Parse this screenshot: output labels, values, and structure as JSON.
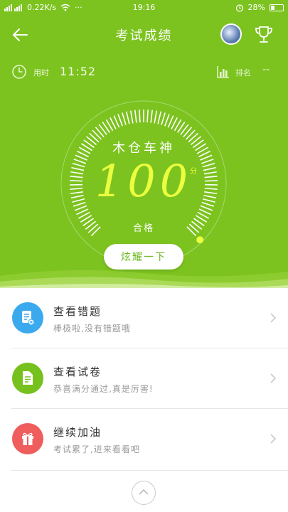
{
  "status_bar": {
    "network": "0.22K/s",
    "time": "19:16",
    "battery": "28%"
  },
  "header": {
    "title": "考试成绩"
  },
  "meta": {
    "time_label": "用时",
    "time_value": "11:52",
    "rank_label": "排名",
    "rank_value": "--"
  },
  "result": {
    "name": "木仓车神",
    "score": "100",
    "unit": "分",
    "status": "合格",
    "score_fraction": 1.0
  },
  "show_off_button": "炫耀一下",
  "list": [
    {
      "title": "查看错题",
      "subtitle": "棒极啦,没有错题哦",
      "icon": "wrong-questions-icon",
      "color": "#3aa9ee"
    },
    {
      "title": "查看试卷",
      "subtitle": "恭喜满分通过,真是厉害!",
      "icon": "exam-paper-icon",
      "color": "#76c11d"
    },
    {
      "title": "继续加油",
      "subtitle": "考试累了,进来看看吧",
      "icon": "gift-icon",
      "color": "#ef5d5d"
    }
  ],
  "colors": {
    "hero_green": "#7cc31f",
    "score_yellow": "#eaff3f"
  }
}
